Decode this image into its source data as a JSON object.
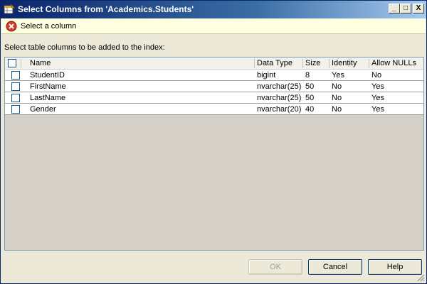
{
  "window": {
    "title": "Select Columns from 'Academics.Students'",
    "controls": {
      "minimize": "_",
      "maximize": "□",
      "close": "X"
    }
  },
  "message": {
    "text": "Select a column",
    "icon": "error-icon"
  },
  "instructions": "Select table columns to be added to the index:",
  "grid": {
    "headers": {
      "name": "Name",
      "data_type": "Data Type",
      "size": "Size",
      "identity": "Identity",
      "allow_nulls": "Allow NULLs"
    },
    "rows": [
      {
        "name": "StudentID",
        "data_type": "bigint",
        "size": "8",
        "identity": "Yes",
        "allow_nulls": "No",
        "checked": false
      },
      {
        "name": "FirstName",
        "data_type": "nvarchar(25)",
        "size": "50",
        "identity": "No",
        "allow_nulls": "Yes",
        "checked": false
      },
      {
        "name": "LastName",
        "data_type": "nvarchar(25)",
        "size": "50",
        "identity": "No",
        "allow_nulls": "Yes",
        "checked": false
      },
      {
        "name": "Gender",
        "data_type": "nvarchar(20)",
        "size": "40",
        "identity": "No",
        "allow_nulls": "Yes",
        "checked": false
      }
    ]
  },
  "buttons": {
    "ok": "OK",
    "cancel": "Cancel",
    "help": "Help"
  }
}
